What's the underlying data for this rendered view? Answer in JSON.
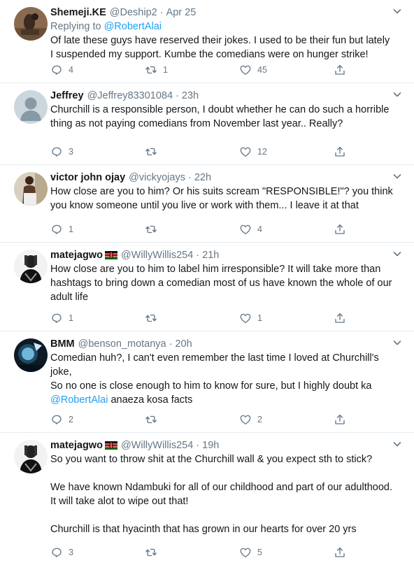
{
  "tweets": [
    {
      "name": "Shemeji.KE",
      "handle": "@Deship2",
      "time": "Apr 25",
      "replying_prefix": "Replying to ",
      "replying_to": "@RobertAlai",
      "text": "Of late these guys have reserved their jokes. I used to be their fun but lately I suspended my support. Kumbe the comedians were on hunger strike!",
      "replies": "4",
      "retweets": "1",
      "likes": "45"
    },
    {
      "name": "Jeffrey",
      "handle": "@Jeffrey83301084",
      "time": "23h",
      "text": "Churchill is a responsible person, I doubt whether he can do such a horrible thing as not paying comedians from November last year.. Really?",
      "replies": "3",
      "retweets": "",
      "likes": "12"
    },
    {
      "name": "victor john ojay",
      "handle": "@vickyojays",
      "time": "22h",
      "text": "How close are you to him?  Or his suits scream \"RESPONSIBLE!\"? you think you know someone until you live or work with them... I leave it at that",
      "replies": "1",
      "retweets": "",
      "likes": "4"
    },
    {
      "name": "matejagwo",
      "handle": "@WillyWillis254",
      "time": "21h",
      "text": "How close are you to him to label him irresponsible? It will take more than hashtags to bring down a comedian most of us have known the whole of our adult life",
      "replies": "1",
      "retweets": "",
      "likes": "1"
    },
    {
      "name": "BMM",
      "handle": "@benson_motanya",
      "time": "20h",
      "text_a": "Comedian huh?, I can't even remember the last time I loved at Churchill's joke,\nSo no one is close enough to him to know for sure, but I highly doubt ka ",
      "mention": "@RobertAlai",
      "text_b": " anaeza kosa facts",
      "replies": "2",
      "retweets": "",
      "likes": "2"
    },
    {
      "name": "matejagwo",
      "handle": "@WillyWillis254",
      "time": "19h",
      "text": "So you want to throw shit at the Churchill wall & you expect sth to stick?\n\nWe have known Ndambuki for all of our childhood and part of our adulthood. It will take alot to wipe out that!\n\nChurchill is that hyacinth that has grown in our hearts for over 20 yrs",
      "replies": "3",
      "retweets": "",
      "likes": "5"
    }
  ],
  "separator": "·",
  "colors": {
    "name": "#14171a",
    "meta": "#657786",
    "link": "#1da1f2",
    "border": "#e6ecf0"
  },
  "icons": [
    "chevron-down-icon",
    "reply-icon",
    "retweet-icon",
    "like-icon",
    "share-icon",
    "kenya-flag-icon"
  ]
}
